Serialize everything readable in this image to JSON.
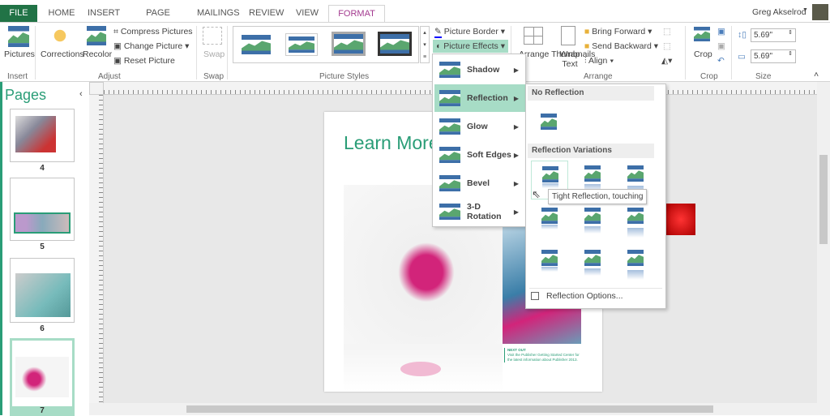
{
  "tabs": {
    "file": "FILE",
    "home": "HOME",
    "insert": "INSERT",
    "page_design": "PAGE DESIGN",
    "mailings": "MAILINGS",
    "review": "REVIEW",
    "view": "VIEW",
    "format": "FORMAT"
  },
  "user": {
    "name": "Greg Akselrod"
  },
  "ribbon": {
    "insert": {
      "pictures": "Pictures",
      "label": "Insert"
    },
    "adjust": {
      "corrections": "Corrections",
      "recolor": "Recolor",
      "compress": "Compress Pictures",
      "change": "Change Picture",
      "reset": "Reset Picture",
      "label": "Adjust"
    },
    "swap": {
      "swap": "Swap",
      "label": "Swap"
    },
    "styles": {
      "label": "Picture Styles",
      "border": "Picture Border",
      "effects": "Picture Effects"
    },
    "arrange": {
      "thumbnails": "Arrange Thumbnails",
      "wrap": "Wrap Text",
      "forward": "Bring Forward",
      "backward": "Send Backward",
      "align": "Align",
      "label": "Arrange"
    },
    "crop": {
      "crop": "Crop",
      "label": "Crop"
    },
    "size": {
      "height": "5.69\"",
      "width": "5.69\"",
      "label": "Size"
    }
  },
  "pages": {
    "title": "Pages",
    "numbers": [
      "4",
      "5",
      "6",
      "7"
    ]
  },
  "document": {
    "heading": "Learn More",
    "caption_title": "NEXT OUT",
    "caption_body": "Visit the Publisher Getting Started Center for the latest information about Publisher 2013."
  },
  "effects_menu": [
    "Shadow",
    "Reflection",
    "Glow",
    "Soft Edges",
    "Bevel",
    "3-D Rotation"
  ],
  "reflection": {
    "no_reflection": "No Reflection",
    "variations": "Reflection Variations",
    "options": "Reflection Options...",
    "tooltip": "Tight Reflection, touching"
  },
  "colors": {
    "accent": "#217346",
    "format": "#a33a8f",
    "highlight": "#a7dcc6",
    "heading": "#2a9d77"
  }
}
